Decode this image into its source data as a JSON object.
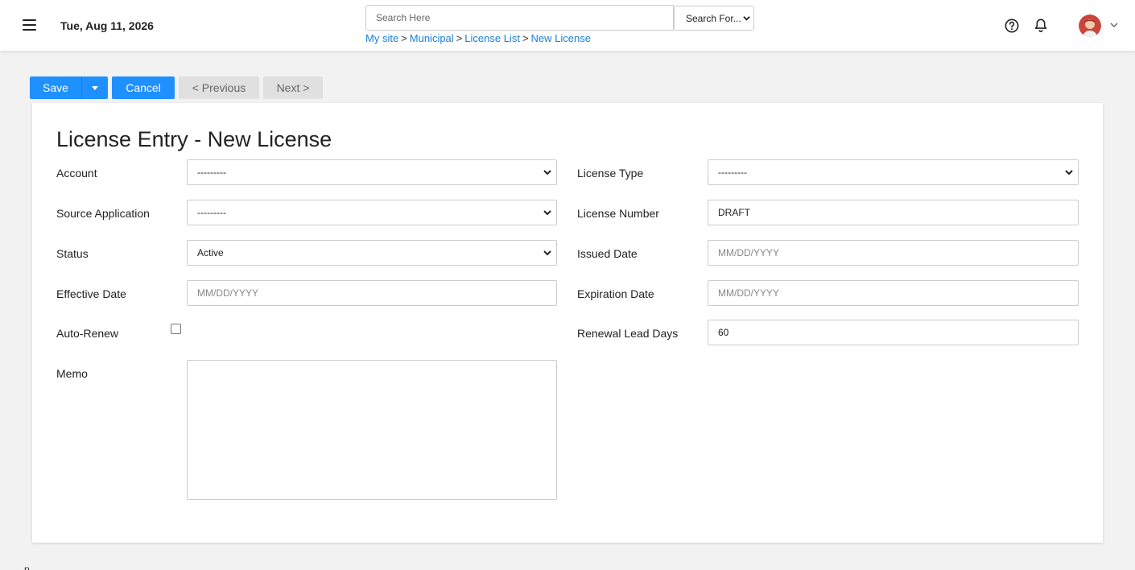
{
  "header": {
    "date": "Tue, Aug 11, 2026",
    "search_placeholder": "Search Here",
    "search_for_label": "Search For...",
    "breadcrumb": [
      "My site",
      "Municipal",
      "License List",
      "New License"
    ],
    "breadcrumb_sep": ">",
    "icons": [
      "hamburger-icon",
      "help-icon",
      "bell-icon",
      "avatar",
      "chevron-down-icon"
    ]
  },
  "toolbar": {
    "save_label": "Save",
    "cancel_label": "Cancel",
    "previous_label": "< Previous",
    "next_label": "Next >"
  },
  "form": {
    "title": "License Entry - New License",
    "left": {
      "account": {
        "label": "Account",
        "value": "---------"
      },
      "source_application": {
        "label": "Source Application",
        "value": "---------"
      },
      "status": {
        "label": "Status",
        "value": "Active"
      },
      "effective_date": {
        "label": "Effective Date",
        "placeholder": "MM/DD/YYYY"
      },
      "auto_renew": {
        "label": "Auto-Renew",
        "checked": false
      },
      "memo": {
        "label": "Memo",
        "value": ""
      }
    },
    "right": {
      "license_type": {
        "label": "License Type",
        "value": "---------"
      },
      "license_number": {
        "label": "License Number",
        "value": "DRAFT"
      },
      "issued_date": {
        "label": "Issued Date",
        "placeholder": "MM/DD/YYYY"
      },
      "expiration_date": {
        "label": "Expiration Date",
        "placeholder": "MM/DD/YYYY"
      },
      "renewal_lead_days": {
        "label": "Renewal Lead Days",
        "value": "60"
      }
    }
  },
  "footer": {
    "text": "p"
  },
  "colors": {
    "primary": "#1e90ff",
    "link": "#1a7fd6",
    "disabled_bg": "#e0e0e0"
  }
}
